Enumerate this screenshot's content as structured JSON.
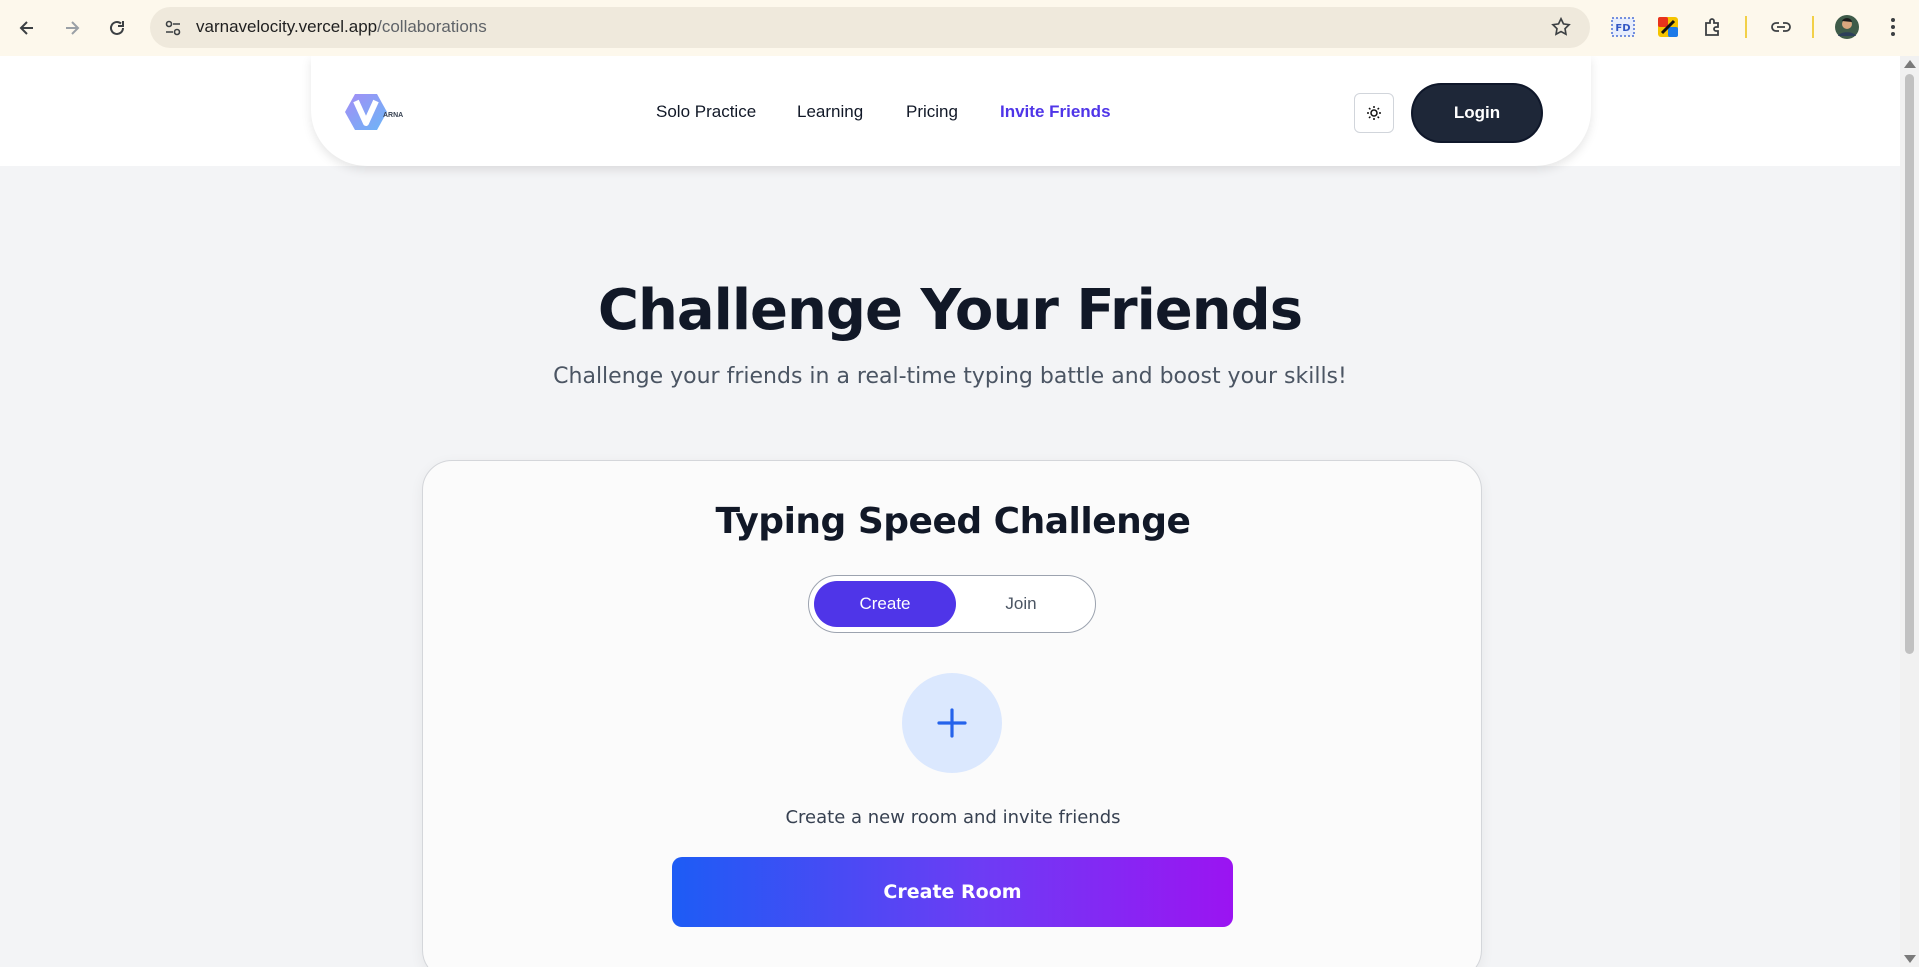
{
  "browser": {
    "url_host": "varnavelocity.vercel.app",
    "url_path": "/collaborations"
  },
  "navbar": {
    "logo_text": "ARNA",
    "items": [
      {
        "label": "Solo Practice"
      },
      {
        "label": "Learning"
      },
      {
        "label": "Pricing"
      },
      {
        "label": "Invite Friends"
      }
    ],
    "login_label": "Login"
  },
  "hero": {
    "title": "Challenge Your Friends",
    "subtitle": "Challenge your friends in a real-time typing battle and boost your skills!"
  },
  "card": {
    "title": "Typing Speed Challenge",
    "tabs": [
      {
        "label": "Create",
        "active": true
      },
      {
        "label": "Join",
        "active": false
      }
    ],
    "description": "Create a new room and invite friends",
    "button_label": "Create Room"
  },
  "colors": {
    "accent": "#4f35e8",
    "login_bg": "#1e2738",
    "gradient_start": "#1d5cf5",
    "gradient_end": "#9b14f2"
  }
}
